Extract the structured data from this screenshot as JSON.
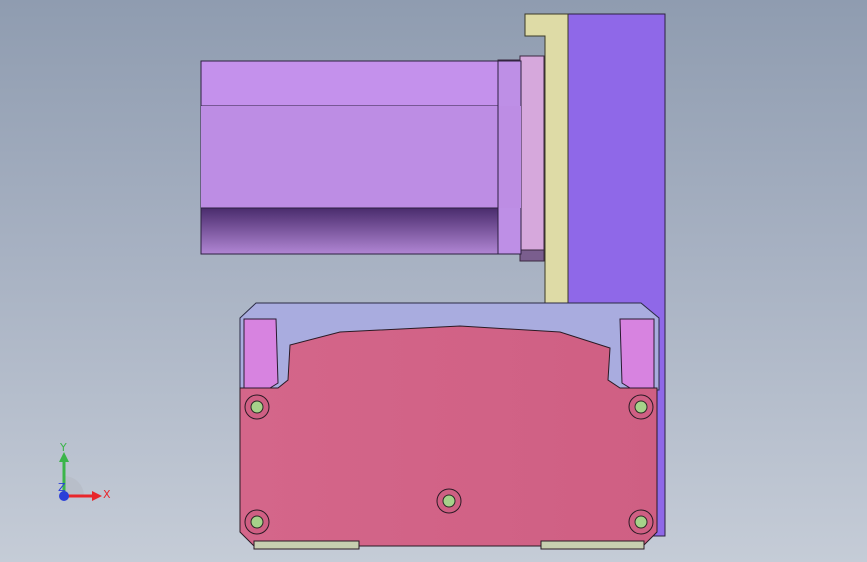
{
  "viewport": {
    "background_top": "#8f9cb0",
    "background_bottom": "#c5ccd7"
  },
  "model": {
    "parts": [
      {
        "name": "motor-body",
        "color": "#be8fe6"
      },
      {
        "name": "motor-flange",
        "color": "#d6a8dc"
      },
      {
        "name": "adapter-plate",
        "color": "#dedba6"
      },
      {
        "name": "mounting-bracket",
        "color": "#8f68e8"
      },
      {
        "name": "gearbox-housing",
        "color": "#d16285"
      },
      {
        "name": "gearbox-top-cover",
        "color": "#a9acdf"
      },
      {
        "name": "gearbox-side-lugs",
        "color": "#d783e0"
      },
      {
        "name": "screw-heads",
        "color": "#a6d28a"
      }
    ]
  },
  "triad": {
    "x_label": "X",
    "y_label": "Y",
    "z_label": "Z",
    "x_color": "#e8262b",
    "y_color": "#3bb54a",
    "z_color": "#2a3fd8"
  }
}
